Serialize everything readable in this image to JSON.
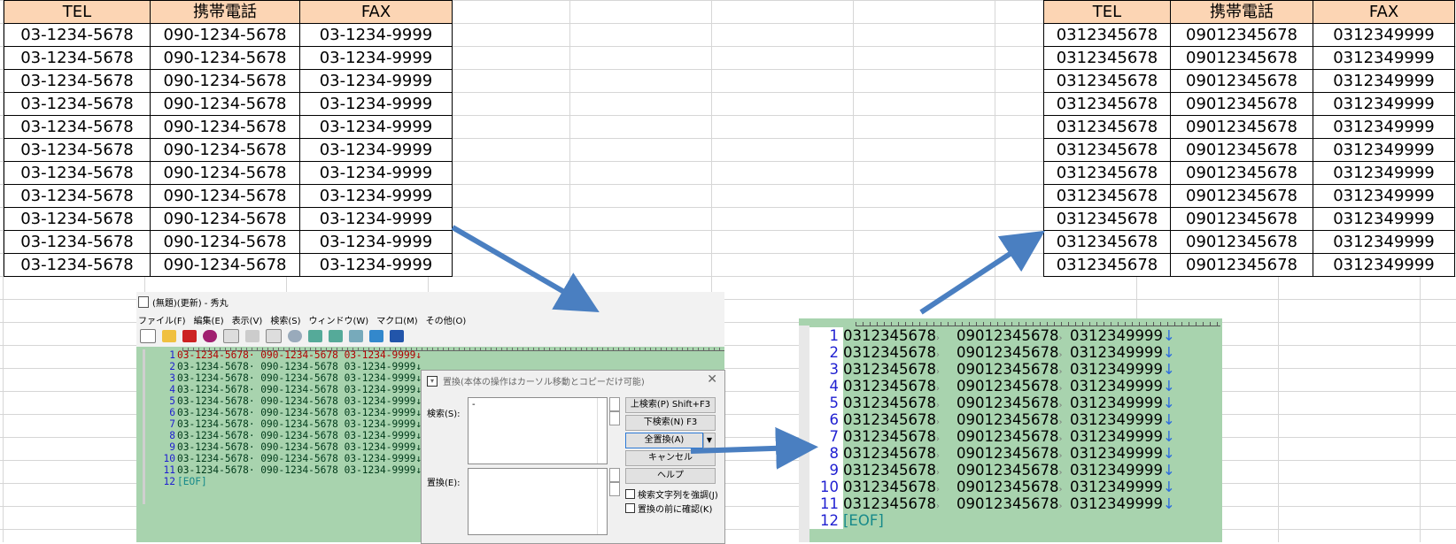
{
  "left_table": {
    "headers": [
      "TEL",
      "携帯電話",
      "FAX"
    ],
    "rows": [
      [
        "03-1234-5678",
        "090-1234-5678",
        "03-1234-9999"
      ],
      [
        "03-1234-5678",
        "090-1234-5678",
        "03-1234-9999"
      ],
      [
        "03-1234-5678",
        "090-1234-5678",
        "03-1234-9999"
      ],
      [
        "03-1234-5678",
        "090-1234-5678",
        "03-1234-9999"
      ],
      [
        "03-1234-5678",
        "090-1234-5678",
        "03-1234-9999"
      ],
      [
        "03-1234-5678",
        "090-1234-5678",
        "03-1234-9999"
      ],
      [
        "03-1234-5678",
        "090-1234-5678",
        "03-1234-9999"
      ],
      [
        "03-1234-5678",
        "090-1234-5678",
        "03-1234-9999"
      ],
      [
        "03-1234-5678",
        "090-1234-5678",
        "03-1234-9999"
      ],
      [
        "03-1234-5678",
        "090-1234-5678",
        "03-1234-9999"
      ],
      [
        "03-1234-5678",
        "090-1234-5678",
        "03-1234-9999"
      ]
    ]
  },
  "right_table": {
    "headers": [
      "TEL",
      "携帯電話",
      "FAX"
    ],
    "rows": [
      [
        "0312345678",
        "09012345678",
        "0312349999"
      ],
      [
        "0312345678",
        "09012345678",
        "0312349999"
      ],
      [
        "0312345678",
        "09012345678",
        "0312349999"
      ],
      [
        "0312345678",
        "09012345678",
        "0312349999"
      ],
      [
        "0312345678",
        "09012345678",
        "0312349999"
      ],
      [
        "0312345678",
        "09012345678",
        "0312349999"
      ],
      [
        "0312345678",
        "09012345678",
        "0312349999"
      ],
      [
        "0312345678",
        "09012345678",
        "0312349999"
      ],
      [
        "0312345678",
        "09012345678",
        "0312349999"
      ],
      [
        "0312345678",
        "09012345678",
        "0312349999"
      ],
      [
        "0312345678",
        "09012345678",
        "0312349999"
      ]
    ]
  },
  "editor_left": {
    "title": "(無題)(更新) - 秀丸",
    "menu": [
      "ファイル(F)",
      "編集(E)",
      "表示(V)",
      "検索(S)",
      "ウィンドウ(W)",
      "マクロ(M)",
      "その他(O)"
    ],
    "lines": [
      {
        "n": "1",
        "text": "03-1234-5678· 090-1234-5678 03-1234-9999↓"
      },
      {
        "n": "2",
        "text": "03-1234-5678· 090-1234-5678 03-1234-9999↓"
      },
      {
        "n": "3",
        "text": "03-1234-5678· 090-1234-5678 03-1234-9999↓"
      },
      {
        "n": "4",
        "text": "03-1234-5678· 090-1234-5678 03-1234-9999↓"
      },
      {
        "n": "5",
        "text": "03-1234-5678· 090-1234-5678 03-1234-9999↓"
      },
      {
        "n": "6",
        "text": "03-1234-5678· 090-1234-5678 03-1234-9999↓"
      },
      {
        "n": "7",
        "text": "03-1234-5678· 090-1234-5678 03-1234-9999↓"
      },
      {
        "n": "8",
        "text": "03-1234-5678· 090-1234-5678 03-1234-9999↓"
      },
      {
        "n": "9",
        "text": "03-1234-5678· 090-1234-5678 03-1234-9999↓"
      },
      {
        "n": "10",
        "text": "03-1234-5678· 090-1234-5678 03-1234-9999↓"
      },
      {
        "n": "11",
        "text": "03-1234-5678· 090-1234-5678 03-1234-9999↓"
      },
      {
        "n": "12",
        "text": "[EOF]"
      }
    ]
  },
  "replace_dialog": {
    "title": "置換(本体の操作はカーソル移動とコピーだけ可能)",
    "search_label": "検索(S):",
    "search_value": "-",
    "replace_label": "置換(E):",
    "replace_value": "",
    "btn_search_up": "上検索(P) Shift+F3",
    "btn_search_down": "下検索(N) F3",
    "btn_replace_all": "全置換(A)",
    "btn_cancel": "キャンセル",
    "btn_help": "ヘルプ",
    "check_highlight": "検索文字列を強調(J)",
    "check_confirm": "置換の前に確認(K)"
  },
  "editor_right": {
    "lines": [
      {
        "n": "1",
        "a": "0312345678",
        "b": "09012345678",
        "c": "0312349999"
      },
      {
        "n": "2",
        "a": "0312345678",
        "b": "09012345678",
        "c": "0312349999"
      },
      {
        "n": "3",
        "a": "0312345678",
        "b": "09012345678",
        "c": "0312349999"
      },
      {
        "n": "4",
        "a": "0312345678",
        "b": "09012345678",
        "c": "0312349999"
      },
      {
        "n": "5",
        "a": "0312345678",
        "b": "09012345678",
        "c": "0312349999"
      },
      {
        "n": "6",
        "a": "0312345678",
        "b": "09012345678",
        "c": "0312349999"
      },
      {
        "n": "7",
        "a": "0312345678",
        "b": "09012345678",
        "c": "0312349999"
      },
      {
        "n": "8",
        "a": "0312345678",
        "b": "09012345678",
        "c": "0312349999"
      },
      {
        "n": "9",
        "a": "0312345678",
        "b": "09012345678",
        "c": "0312349999"
      },
      {
        "n": "10",
        "a": "0312345678",
        "b": "09012345678",
        "c": "0312349999"
      },
      {
        "n": "11",
        "a": "0312345678",
        "b": "09012345678",
        "c": "0312349999"
      }
    ],
    "eof_number": "12",
    "eof_text": "[EOF]"
  },
  "colors": {
    "header_fill": "#fcd5b4",
    "editor_bg": "#a8d3ae",
    "arrow": "#4a7fc1",
    "line_number": "#1f1fd1"
  }
}
